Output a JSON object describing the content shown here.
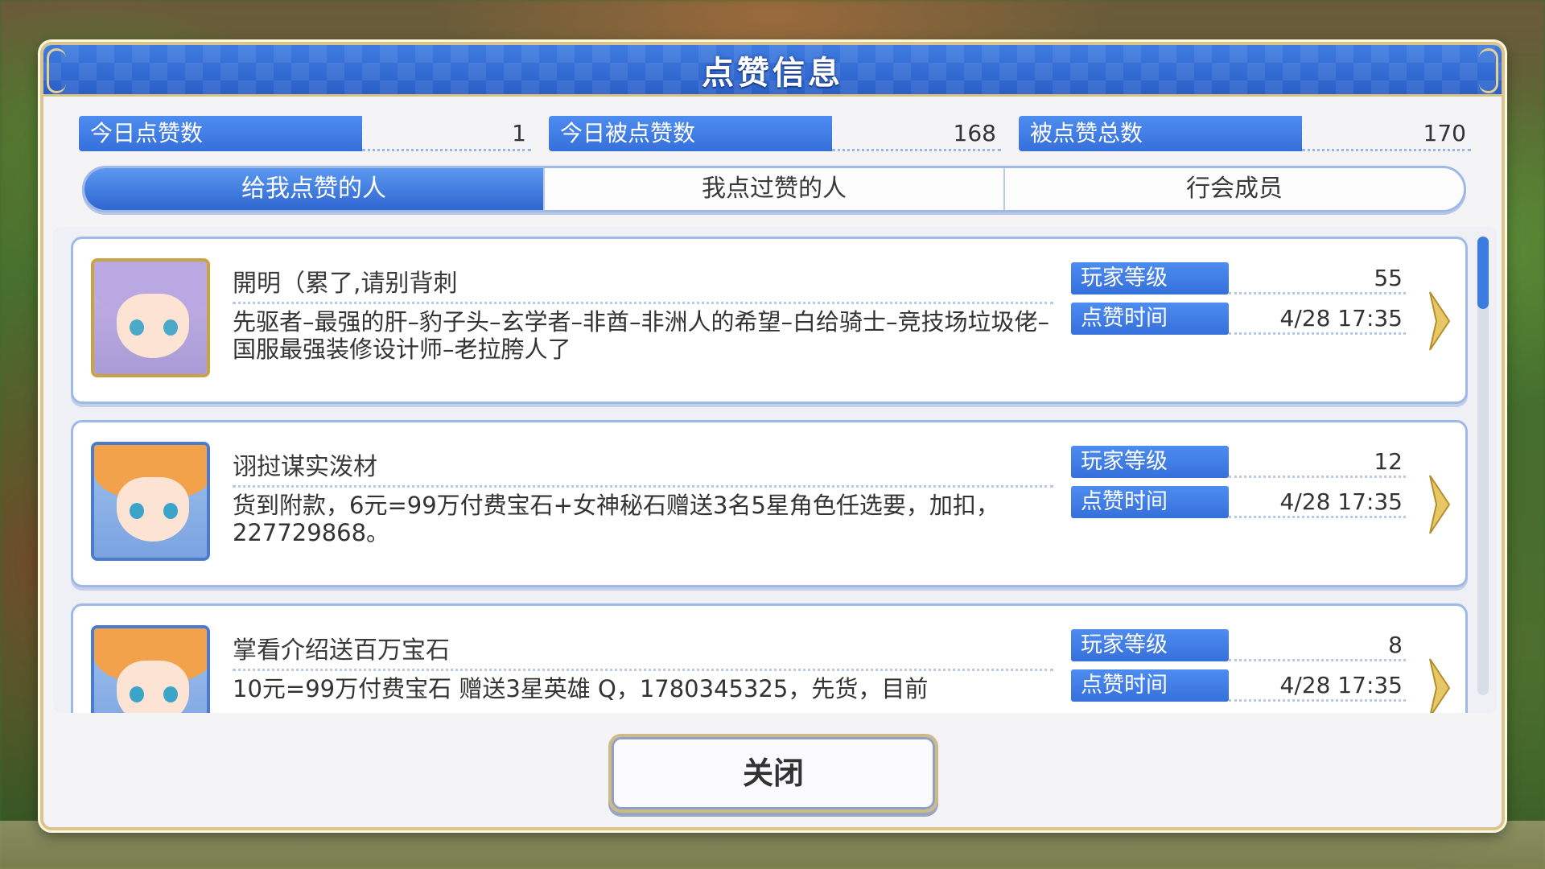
{
  "dialog": {
    "title": "点赞信息"
  },
  "stats": [
    {
      "label": "今日点赞数",
      "value": "1"
    },
    {
      "label": "今日被点赞数",
      "value": "168"
    },
    {
      "label": "被点赞总数",
      "value": "170"
    }
  ],
  "tabs": [
    {
      "label": "给我点赞的人",
      "active": true
    },
    {
      "label": "我点过赞的人",
      "active": false
    },
    {
      "label": "行会成员",
      "active": false
    }
  ],
  "entries": [
    {
      "name": "開明（累了,请别背刺",
      "description": "先驱者–最强的肝–豹子头–玄学者–非酋–非洲人的希望–白给骑士–竞技场垃圾佬–国服最强装修设计师–老拉胯人了",
      "level_label": "玩家等级",
      "level": "55",
      "time_label": "点赞时间",
      "time": "4/28 17:35",
      "avatar_icon": "purple-hair-character-avatar"
    },
    {
      "name": "诩挝谋实泼材",
      "description": "货到附款，6元=99万付费宝石+女神秘石赠送3名5星角色任选要，加扣，227729868。",
      "level_label": "玩家等级",
      "level": "12",
      "time_label": "点赞时间",
      "time": "4/28 17:35",
      "avatar_icon": "orange-hair-character-avatar"
    },
    {
      "name": "掌看介绍送百万宝石",
      "description": "10元=99万付费宝石 赠送3星英雄 Q，1780345325，先货，目前",
      "level_label": "玩家等级",
      "level": "8",
      "time_label": "点赞时间",
      "time": "4/28 17:35",
      "avatar_icon": "orange-hair-character-avatar"
    }
  ],
  "buttons": {
    "close": "关闭"
  },
  "colors": {
    "accent_blue": "#3670db",
    "header_blue": "#2a5fc8",
    "gold_border": "#d9c48d"
  }
}
